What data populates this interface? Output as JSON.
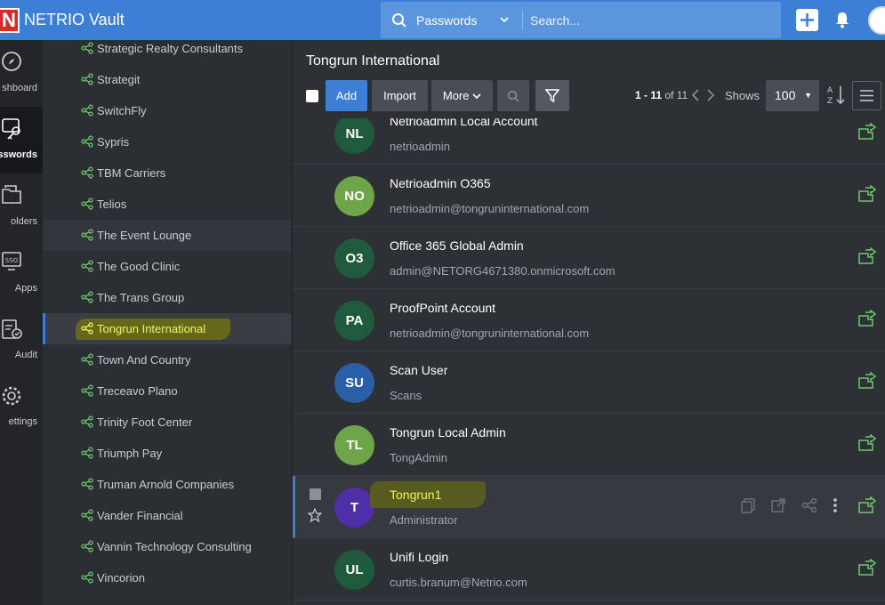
{
  "app": {
    "logo_letter": "N",
    "title": "NETRIO Vault"
  },
  "search": {
    "scope": "Passwords",
    "placeholder": "Search..."
  },
  "rail": [
    {
      "label": "shboard",
      "icon": "compass-icon"
    },
    {
      "label": "sswords",
      "icon": "key-icon",
      "active": true
    },
    {
      "label": "olders",
      "icon": "folder-icon"
    },
    {
      "label": "Apps",
      "icon": "sso-icon"
    },
    {
      "label": "Audit",
      "icon": "audit-icon"
    },
    {
      "label": "ettings",
      "icon": "gear-icon"
    }
  ],
  "sidebar": {
    "items": [
      {
        "label": "Strategic Realty Consultants"
      },
      {
        "label": "Strategit"
      },
      {
        "label": "SwitchFly"
      },
      {
        "label": "Sypris"
      },
      {
        "label": "TBM Carriers"
      },
      {
        "label": "Telios"
      },
      {
        "label": "The Event Lounge"
      },
      {
        "label": "The Good Clinic"
      },
      {
        "label": "The Trans Group"
      },
      {
        "label": "Tongrun International"
      },
      {
        "label": "Town And Country"
      },
      {
        "label": "Treceavo Plano"
      },
      {
        "label": "Trinity Foot Center"
      },
      {
        "label": "Triumph Pay"
      },
      {
        "label": "Truman Arnold Companies"
      },
      {
        "label": "Vander Financial"
      },
      {
        "label": "Vannin Technology Consulting"
      },
      {
        "label": "Vincorion"
      }
    ]
  },
  "main": {
    "title": "Tongrun International",
    "toolbar": {
      "add": "Add",
      "import": "Import",
      "more": "More",
      "page_range": "1 - 11",
      "page_of": "of 11",
      "shows_label": "Shows",
      "shows_value": "100"
    },
    "rows": [
      {
        "initials": "NL",
        "name": "Netrioadmin Local Account",
        "user": "netrioadmin",
        "color": "#1f5a3c"
      },
      {
        "initials": "NO",
        "name": "Netrioadmin O365",
        "user": "netrioadmin@tongruninternational.com",
        "color": "#6ea548"
      },
      {
        "initials": "O3",
        "name": "Office 365 Global Admin",
        "user": "admin@NETORG4671380.onmicrosoft.com",
        "color": "#1f5a3c"
      },
      {
        "initials": "PA",
        "name": "ProofPoint Account",
        "user": "netrioadmin@tongruninternational.com",
        "color": "#1f5a3c"
      },
      {
        "initials": "SU",
        "name": "Scan User",
        "user": "Scans",
        "color": "#2a5fa8"
      },
      {
        "initials": "TL",
        "name": "Tongrun Local Admin",
        "user": "TongAdmin",
        "color": "#6ea548"
      },
      {
        "initials": "T",
        "name": "Tongrun1",
        "user": "Administrator",
        "color": "#4e2fa8"
      },
      {
        "initials": "UL",
        "name": "Unifi Login",
        "user": "curtis.branum@Netrio.com",
        "color": "#1f5a3c"
      }
    ]
  }
}
